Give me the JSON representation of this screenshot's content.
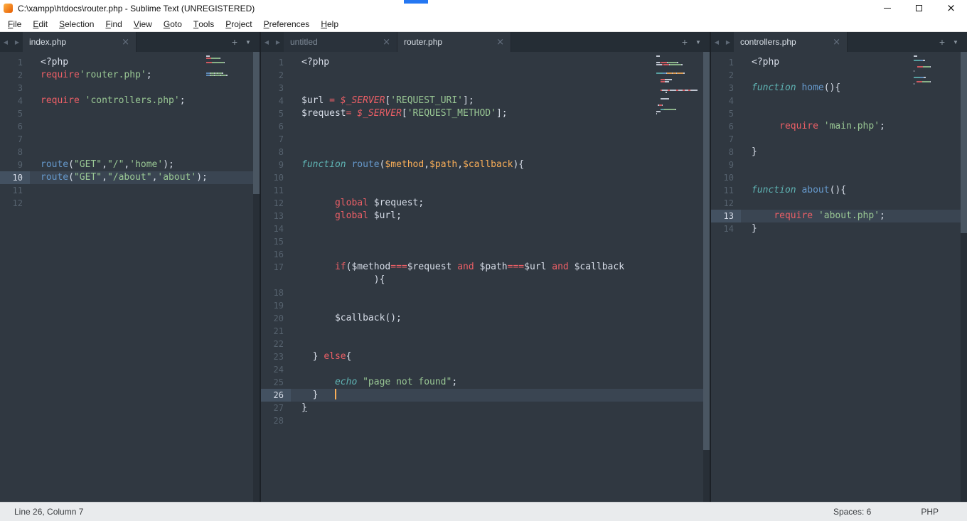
{
  "window": {
    "title": "C:\\xampp\\htdocs\\router.php - Sublime Text (UNREGISTERED)"
  },
  "menu": {
    "items": [
      "File",
      "Edit",
      "Selection",
      "Find",
      "View",
      "Goto",
      "Tools",
      "Project",
      "Preferences",
      "Help"
    ]
  },
  "status": {
    "position": "Line 26, Column 7",
    "spaces": "Spaces: 6",
    "syntax": "PHP"
  },
  "icons": {
    "tab_scroll_left": "◀",
    "tab_scroll_right": "▶",
    "tab_close": "×",
    "new_tab": "+",
    "tab_overflow": "▼"
  },
  "theme": {
    "editor_bg": "#303841",
    "tab_bar_bg": "#252d35",
    "active_tab_bg": "#303841",
    "line_highlight": "#3a4552",
    "gutter_highlight": "#435161",
    "gutter_text": "#56626e",
    "caret": "#f9ae58",
    "status_bg": "#e9ebed",
    "tokens": {
      "w": "#d8dee9",
      "r": "#ec5f66",
      "ri": "#ec5f66",
      "g": "#99c794",
      "b": "#6699cc",
      "ci": "#5fb4b4",
      "o": "#f9ae58",
      "wu": "#d8dee9"
    }
  },
  "panes": [
    {
      "id": "left",
      "tabs": [
        {
          "label": "index.php",
          "active": true
        }
      ],
      "active_line": 10,
      "scrollbar_thumb": 200,
      "lines": [
        {
          "n": 1,
          "s": [
            [
              "<?php",
              "w"
            ]
          ]
        },
        {
          "n": 2,
          "s": [
            [
              "require",
              "r"
            ],
            [
              "'router.php'",
              "g"
            ],
            [
              ";",
              "w"
            ]
          ]
        },
        {
          "n": 3,
          "s": []
        },
        {
          "n": 4,
          "s": [
            [
              "require ",
              "r"
            ],
            [
              "'controllers.php'",
              "g"
            ],
            [
              ";",
              "w"
            ]
          ]
        },
        {
          "n": 5,
          "s": []
        },
        {
          "n": 6,
          "s": []
        },
        {
          "n": 7,
          "s": []
        },
        {
          "n": 8,
          "s": []
        },
        {
          "n": 9,
          "s": [
            [
              "route",
              "b"
            ],
            [
              "(",
              "w"
            ],
            [
              "\"GET\"",
              "g"
            ],
            [
              ",",
              "w"
            ],
            [
              "\"/\"",
              "g"
            ],
            [
              ",",
              "w"
            ],
            [
              "'home'",
              "g"
            ],
            [
              ");",
              "w"
            ]
          ]
        },
        {
          "n": 10,
          "s": [
            [
              "route",
              "b"
            ],
            [
              "(",
              "w"
            ],
            [
              "\"GET\"",
              "g"
            ],
            [
              ",",
              "w"
            ],
            [
              "\"/about\"",
              "g"
            ],
            [
              ",",
              "w"
            ],
            [
              "'about'",
              "g"
            ],
            [
              ");",
              "w"
            ]
          ]
        },
        {
          "n": 11,
          "s": []
        },
        {
          "n": 12,
          "s": []
        }
      ]
    },
    {
      "id": "middle",
      "tabs": [
        {
          "label": "untitled",
          "active": false
        },
        {
          "label": "router.php",
          "active": true
        }
      ],
      "active_line": 26,
      "scrollbar_thumb": 560,
      "lines": [
        {
          "n": 1,
          "s": [
            [
              "<?php",
              "w"
            ]
          ]
        },
        {
          "n": 2,
          "s": []
        },
        {
          "n": 3,
          "s": []
        },
        {
          "n": 4,
          "s": [
            [
              "$url ",
              "w"
            ],
            [
              "=",
              "r"
            ],
            [
              " ",
              "w"
            ],
            [
              "$_SERVER",
              "ri"
            ],
            [
              "[",
              "w"
            ],
            [
              "'REQUEST_URI'",
              "g"
            ],
            [
              "];",
              "w"
            ]
          ]
        },
        {
          "n": 5,
          "s": [
            [
              "$request",
              "w"
            ],
            [
              "=",
              "r"
            ],
            [
              " ",
              "w"
            ],
            [
              "$_SERVER",
              "ri"
            ],
            [
              "[",
              "w"
            ],
            [
              "'REQUEST_METHOD'",
              "g"
            ],
            [
              "];",
              "w"
            ]
          ]
        },
        {
          "n": 6,
          "s": []
        },
        {
          "n": 7,
          "s": []
        },
        {
          "n": 8,
          "s": []
        },
        {
          "n": 9,
          "s": [
            [
              "function ",
              "ci"
            ],
            [
              "route",
              "b"
            ],
            [
              "(",
              "w"
            ],
            [
              "$method",
              "o"
            ],
            [
              ",",
              "w"
            ],
            [
              "$path",
              "o"
            ],
            [
              ",",
              "w"
            ],
            [
              "$callback",
              "o"
            ],
            [
              "){",
              "w"
            ]
          ]
        },
        {
          "n": 10,
          "s": []
        },
        {
          "n": 11,
          "s": []
        },
        {
          "n": 12,
          "s": [
            [
              "      ",
              "w"
            ],
            [
              "global",
              "r"
            ],
            [
              " $request;",
              "w"
            ]
          ]
        },
        {
          "n": 13,
          "s": [
            [
              "      ",
              "w"
            ],
            [
              "global",
              "r"
            ],
            [
              " $url;",
              "w"
            ]
          ]
        },
        {
          "n": 14,
          "s": []
        },
        {
          "n": 15,
          "s": []
        },
        {
          "n": 16,
          "s": []
        },
        {
          "n": 17,
          "s": [
            [
              "      ",
              "w"
            ],
            [
              "if",
              "r"
            ],
            [
              "(",
              "w"
            ],
            [
              "$method",
              "w"
            ],
            [
              "===",
              "r"
            ],
            [
              "$request ",
              "w"
            ],
            [
              "and",
              "r"
            ],
            [
              " $path",
              "w"
            ],
            [
              "===",
              "r"
            ],
            [
              "$url ",
              "w"
            ],
            [
              "and",
              "r"
            ],
            [
              " $callback",
              "w"
            ]
          ]
        },
        {
          "n": null,
          "s": [
            [
              "             ",
              "w"
            ],
            [
              "){",
              "w"
            ]
          ]
        },
        {
          "n": 18,
          "s": []
        },
        {
          "n": 19,
          "s": []
        },
        {
          "n": 20,
          "s": [
            [
              "      ",
              "w"
            ],
            [
              "$callback();",
              "w"
            ]
          ]
        },
        {
          "n": 21,
          "s": []
        },
        {
          "n": 22,
          "s": []
        },
        {
          "n": 23,
          "s": [
            [
              "  ",
              "w"
            ],
            [
              "} ",
              "w"
            ],
            [
              "else",
              "r"
            ],
            [
              "{",
              "w"
            ]
          ]
        },
        {
          "n": 24,
          "s": []
        },
        {
          "n": 25,
          "s": [
            [
              "      ",
              "w"
            ],
            [
              "echo ",
              "ci"
            ],
            [
              "\"page not found\"",
              "g"
            ],
            [
              ";",
              "w"
            ]
          ]
        },
        {
          "n": 26,
          "s": [
            [
              "  }   ",
              "w"
            ],
            [
              "",
              "caret"
            ]
          ]
        },
        {
          "n": 27,
          "s": [
            [
              "}",
              "wu"
            ]
          ]
        },
        {
          "n": 28,
          "s": []
        }
      ]
    },
    {
      "id": "right",
      "tabs": [
        {
          "label": "controllers.php",
          "active": true
        }
      ],
      "active_line": 13,
      "scrollbar_thumb": 255,
      "lines": [
        {
          "n": 1,
          "s": [
            [
              "<?php",
              "w"
            ]
          ]
        },
        {
          "n": 2,
          "s": []
        },
        {
          "n": 3,
          "s": [
            [
              "function ",
              "ci"
            ],
            [
              "home",
              "b"
            ],
            [
              "(){",
              "w"
            ]
          ]
        },
        {
          "n": 4,
          "s": []
        },
        {
          "n": 5,
          "s": []
        },
        {
          "n": 6,
          "s": [
            [
              "     ",
              "w"
            ],
            [
              "require ",
              "r"
            ],
            [
              "'main.php'",
              "g"
            ],
            [
              ";",
              "w"
            ]
          ]
        },
        {
          "n": 7,
          "s": []
        },
        {
          "n": 8,
          "s": [
            [
              "}",
              "w"
            ]
          ]
        },
        {
          "n": 9,
          "s": []
        },
        {
          "n": 10,
          "s": []
        },
        {
          "n": 11,
          "s": [
            [
              "function ",
              "ci"
            ],
            [
              "about",
              "b"
            ],
            [
              "(){",
              "w"
            ]
          ]
        },
        {
          "n": 12,
          "s": []
        },
        {
          "n": 13,
          "s": [
            [
              "    ",
              "w"
            ],
            [
              "require ",
              "r"
            ],
            [
              "'about.php'",
              "g"
            ],
            [
              ";",
              "w"
            ]
          ]
        },
        {
          "n": 14,
          "s": [
            [
              "}",
              "w"
            ]
          ]
        }
      ]
    }
  ]
}
